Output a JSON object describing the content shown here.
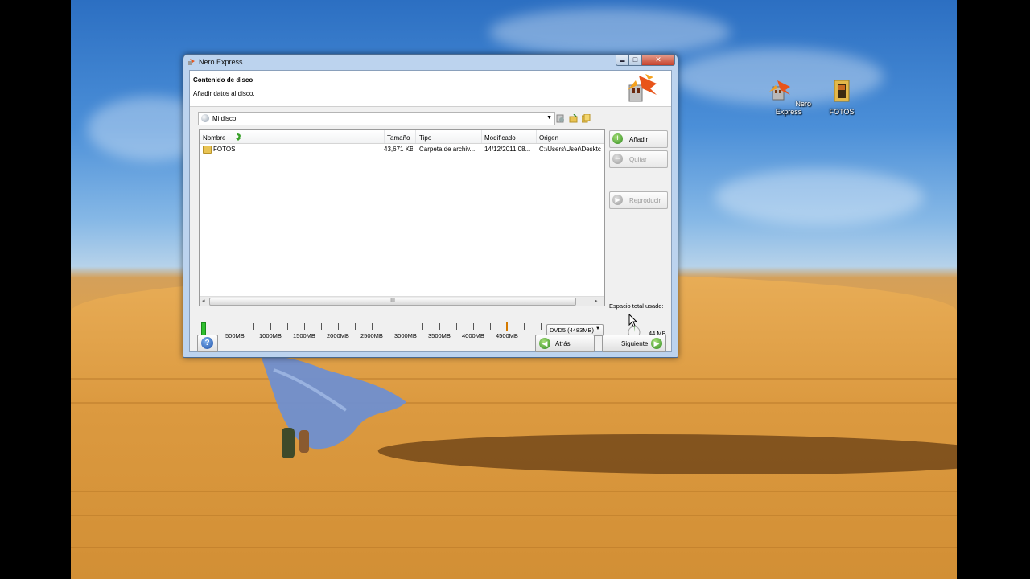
{
  "desktop": {
    "icons": [
      {
        "label": "Nero Express",
        "icon": "nero-express-icon"
      },
      {
        "label": "FOTOS",
        "icon": "folder-icon"
      }
    ]
  },
  "window": {
    "title": "Nero Express",
    "controls": {
      "minimize": "▬",
      "maximize": "□",
      "close": "✕"
    }
  },
  "header": {
    "title": "Contenido de disco",
    "subtitle": "Añadir datos al disco."
  },
  "compilation": {
    "name": "Mi disco"
  },
  "file_list": {
    "columns": [
      "Nombre",
      "Tamaño",
      "Tipo",
      "Modificado",
      "Origen"
    ],
    "rows": [
      {
        "name": "FOTOS",
        "size": "43,671 KB",
        "type": "Carpeta de archiv...",
        "modified": "14/12/2011 08...",
        "origin": "C:\\Users\\User\\Desktc"
      }
    ],
    "scroll_grip": "III"
  },
  "side_buttons": {
    "add": "Añadir",
    "remove": "Quitar",
    "play": "Reproducir"
  },
  "space": {
    "label": "Espacio total usado:",
    "value": "44 MB"
  },
  "ruler": {
    "labels": [
      "500MB",
      "1000MB",
      "1500MB",
      "2000MB",
      "2500MB",
      "3000MB",
      "3500MB",
      "4000MB",
      "4500MB"
    ],
    "used_mb": 44,
    "capacity_mb": 4483
  },
  "disc_type": {
    "selected": "DVD5 (4483MB)"
  },
  "nav": {
    "back": "Atrás",
    "next": "Siguiente",
    "help": "?"
  },
  "colors": {
    "accent_green": "#2e8a1e",
    "folder": "#e9c454",
    "capacity_marker": "#d47a00"
  }
}
